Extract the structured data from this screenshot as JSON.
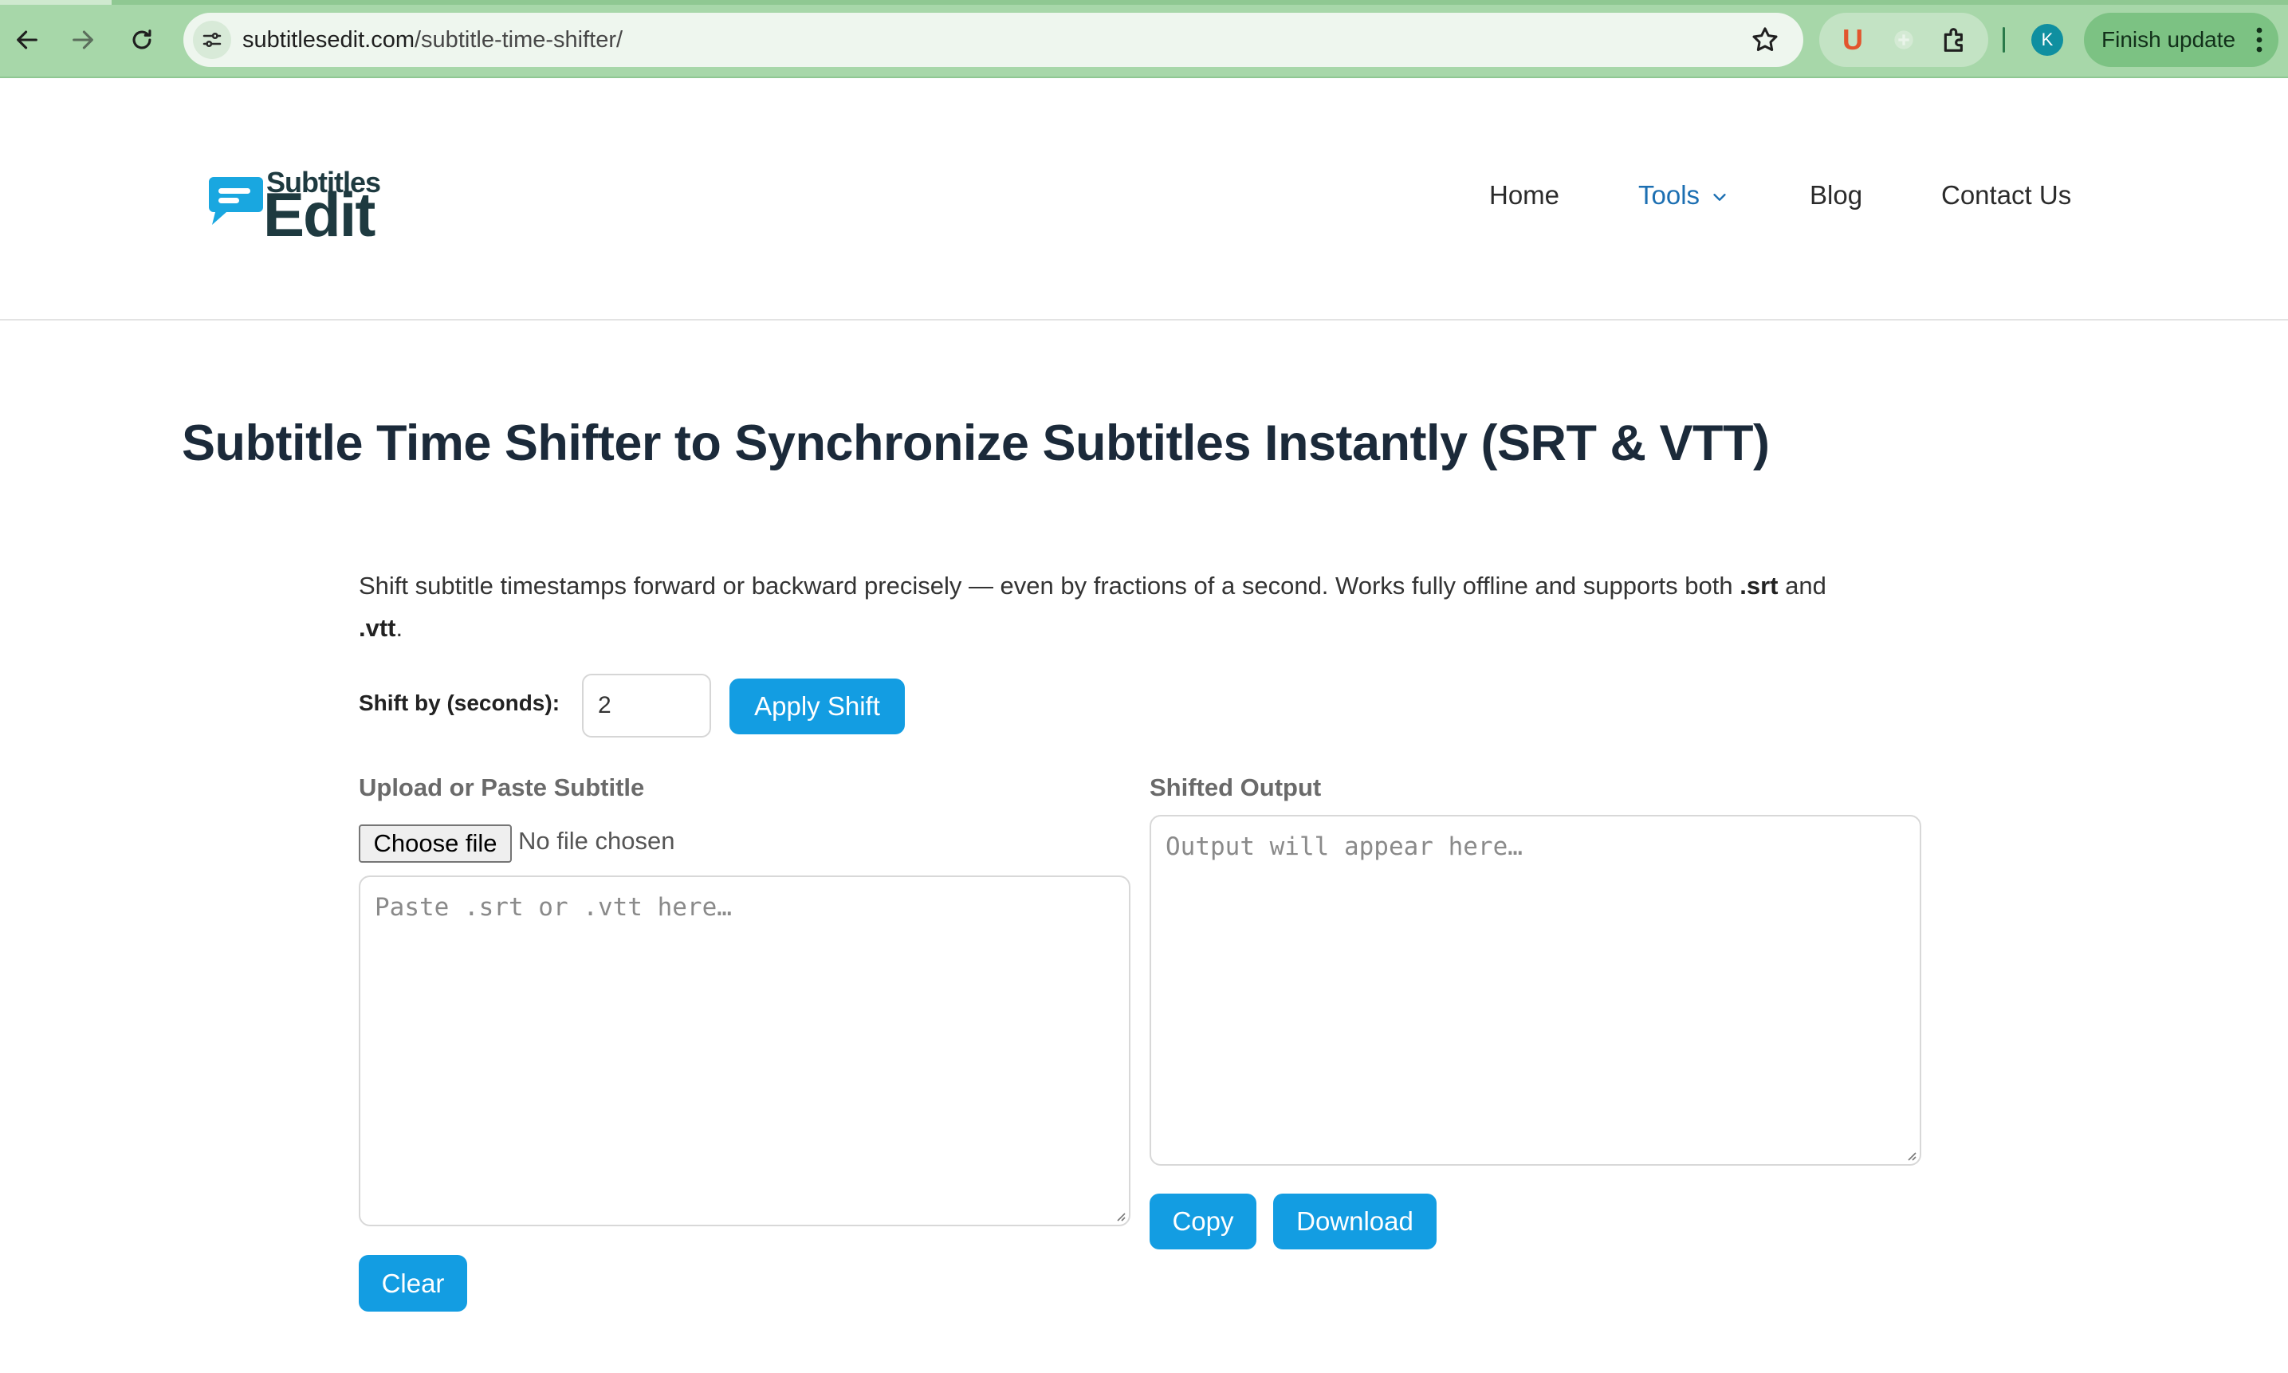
{
  "browser": {
    "url_host": "subtitlesedit.com",
    "url_path": "/subtitle-time-shifter/",
    "extension_letter": "U",
    "profile_initial": "K",
    "update_label": "Finish update",
    "icons": [
      "back-icon",
      "forward-icon",
      "reload-icon",
      "site-info-icon",
      "bookmark-star-icon",
      "puzzle-icon",
      "more-vert-icon"
    ]
  },
  "site": {
    "logo": {
      "line1": "Subtitles",
      "line2": "Edit",
      "accent": "#19a7e0",
      "text_color": "#1e3a40"
    },
    "nav": [
      {
        "label": "Home"
      },
      {
        "label": "Tools"
      },
      {
        "label": "Blog"
      },
      {
        "label": "Contact Us"
      }
    ],
    "active_nav_color": "#1c6fb2"
  },
  "page": {
    "title": "Subtitle Time Shifter to Synchronize Subtitles Instantly (SRT & VTT)",
    "intro_text": "Shift subtitle timestamps forward or backward precisely — even by fractions of a second. Works fully offline and supports both ",
    "intro_srt": ".srt",
    "intro_and": " and ",
    "intro_vtt": ".vtt",
    "intro_end": ".",
    "shift_label": "Shift by (seconds):",
    "shift_value": "2",
    "apply_label": "Apply Shift",
    "upload_label": "Upload or Paste Subtitle",
    "choose_file_label": "Choose file",
    "file_status": "No file chosen",
    "input_placeholder": "Paste .srt or .vtt here…",
    "output_label": "Shifted Output",
    "output_placeholder": "Output will appear here…",
    "copy_label": "Copy",
    "download_label": "Download",
    "clear_label": "Clear",
    "button_color": "#139de2"
  }
}
